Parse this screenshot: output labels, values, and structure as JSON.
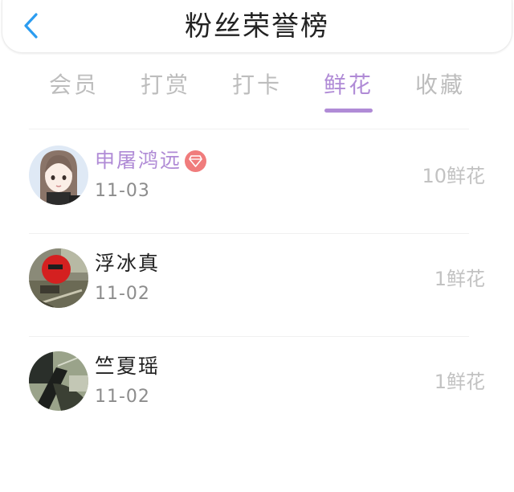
{
  "header": {
    "title": "粉丝荣誉榜",
    "back_icon": "chevron-left-icon",
    "accent_color": "#2b9cf0"
  },
  "tabs": [
    {
      "label": "会员",
      "active": false
    },
    {
      "label": "打赏",
      "active": false
    },
    {
      "label": "打卡",
      "active": false
    },
    {
      "label": "鲜花",
      "active": true
    },
    {
      "label": "收藏",
      "active": false
    }
  ],
  "active_color": "#b08bd6",
  "fans": [
    {
      "name": "申屠鸿远",
      "date": "11-03",
      "amount": "10鲜花",
      "vip": true,
      "badge_icon": "diamond-icon"
    },
    {
      "name": "浮冰真",
      "date": "11-02",
      "amount": "1鲜花",
      "vip": false
    },
    {
      "name": "竺夏瑶",
      "date": "11-02",
      "amount": "1鲜花",
      "vip": false
    }
  ]
}
